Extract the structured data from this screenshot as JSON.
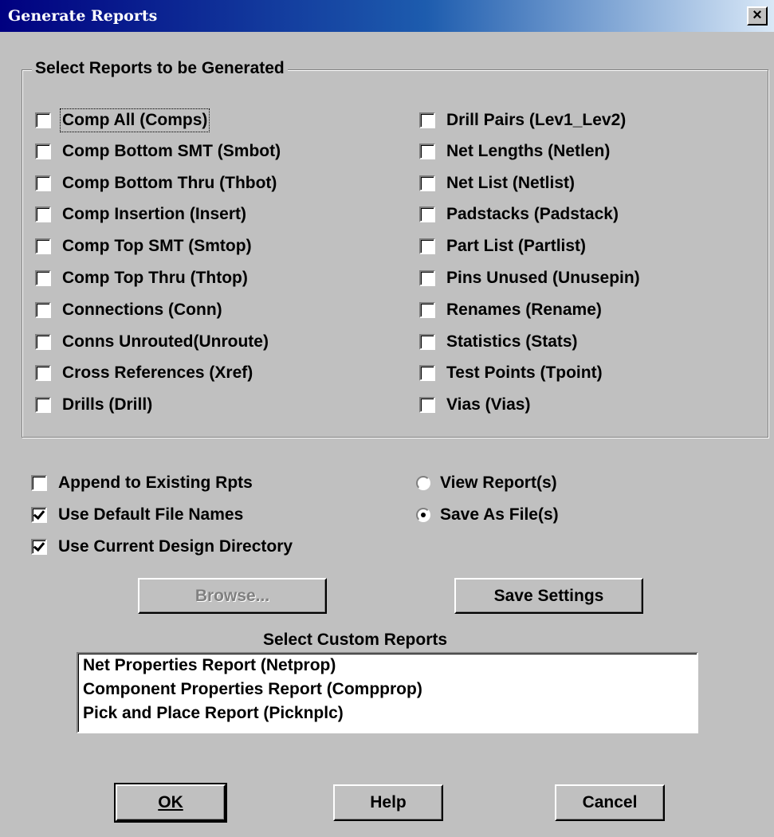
{
  "window": {
    "title": "Generate Reports",
    "close_glyph": "×"
  },
  "reports_group": {
    "legend": "Select Reports to be Generated",
    "left_column": [
      "Comp All (Comps)",
      "Comp Bottom SMT (Smbot)",
      "Comp Bottom Thru (Thbot)",
      "Comp Insertion (Insert)",
      "Comp Top SMT (Smtop)",
      "Comp Top Thru (Thtop)",
      "Connections (Conn)",
      "Conns Unrouted(Unroute)",
      "Cross References (Xref)",
      "Drills (Drill)"
    ],
    "right_column": [
      "Drill Pairs (Lev1_Lev2)",
      "Net Lengths (Netlen)",
      "Net List (Netlist)",
      "Padstacks (Padstack)",
      "Part List (Partlist)",
      "Pins Unused (Unusepin)",
      "Renames (Rename)",
      "Statistics (Stats)",
      "Test Points (Tpoint)",
      "Vias (Vias)"
    ]
  },
  "options": {
    "append": {
      "label": "Append to Existing Rpts",
      "checked": false
    },
    "default_names": {
      "label": "Use Default File Names",
      "checked": true
    },
    "current_dir": {
      "label": "Use Current Design Directory",
      "checked": true
    }
  },
  "output_mode": {
    "view": {
      "label": "View Report(s)",
      "selected": false
    },
    "save": {
      "label": "Save As File(s)",
      "selected": true
    }
  },
  "buttons": {
    "browse": "Browse...",
    "save_settings": "Save Settings",
    "ok": "OK",
    "help": "Help",
    "cancel": "Cancel"
  },
  "custom_reports": {
    "title": "Select Custom Reports",
    "items": [
      "Net Properties Report  (Netprop)",
      "Component Properties Report  (Compprop)",
      "Pick and Place Report  (Picknplc)"
    ]
  }
}
